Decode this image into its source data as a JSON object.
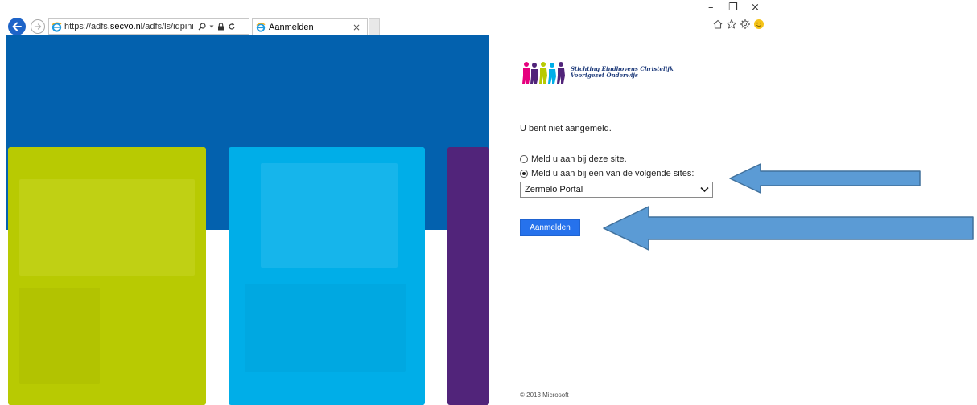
{
  "browser": {
    "url_prefix": "https://adfs.",
    "url_host": "secvo.nl",
    "url_path": "/adfs/ls/idpinitiatedsignon.as",
    "tab_title": "Aanmelden",
    "tab_close": "×",
    "window_controls": {
      "minimize": "–",
      "restore": "❐",
      "close": "×"
    }
  },
  "logo": {
    "line1": "Stichting Eindhovens Christelijk",
    "line2": "Voortgezet Onderwijs",
    "figure_colors": [
      "#e6007e",
      "#51247a",
      "#b8ca02",
      "#00aee8",
      "#51247a"
    ]
  },
  "login": {
    "status_text": "U bent niet aangemeld.",
    "option_this_site": "Meld u aan bij deze site.",
    "option_other_site": "Meld u aan bij een van de volgende sites:",
    "selected_option": "option_other_site",
    "site_select_value": "Zermelo Portal",
    "sign_in_label": "Aanmelden"
  },
  "footer": {
    "copyright": "© 2013 Microsoft"
  },
  "colors": {
    "illustration_blue": "#0361ae",
    "tile_green": "#b8ca02",
    "tile_cyan": "#00aee8",
    "tile_purple": "#51247a",
    "button_blue": "#2672ec",
    "arrow_fill": "#5b9bd5",
    "arrow_stroke": "#41719c"
  }
}
